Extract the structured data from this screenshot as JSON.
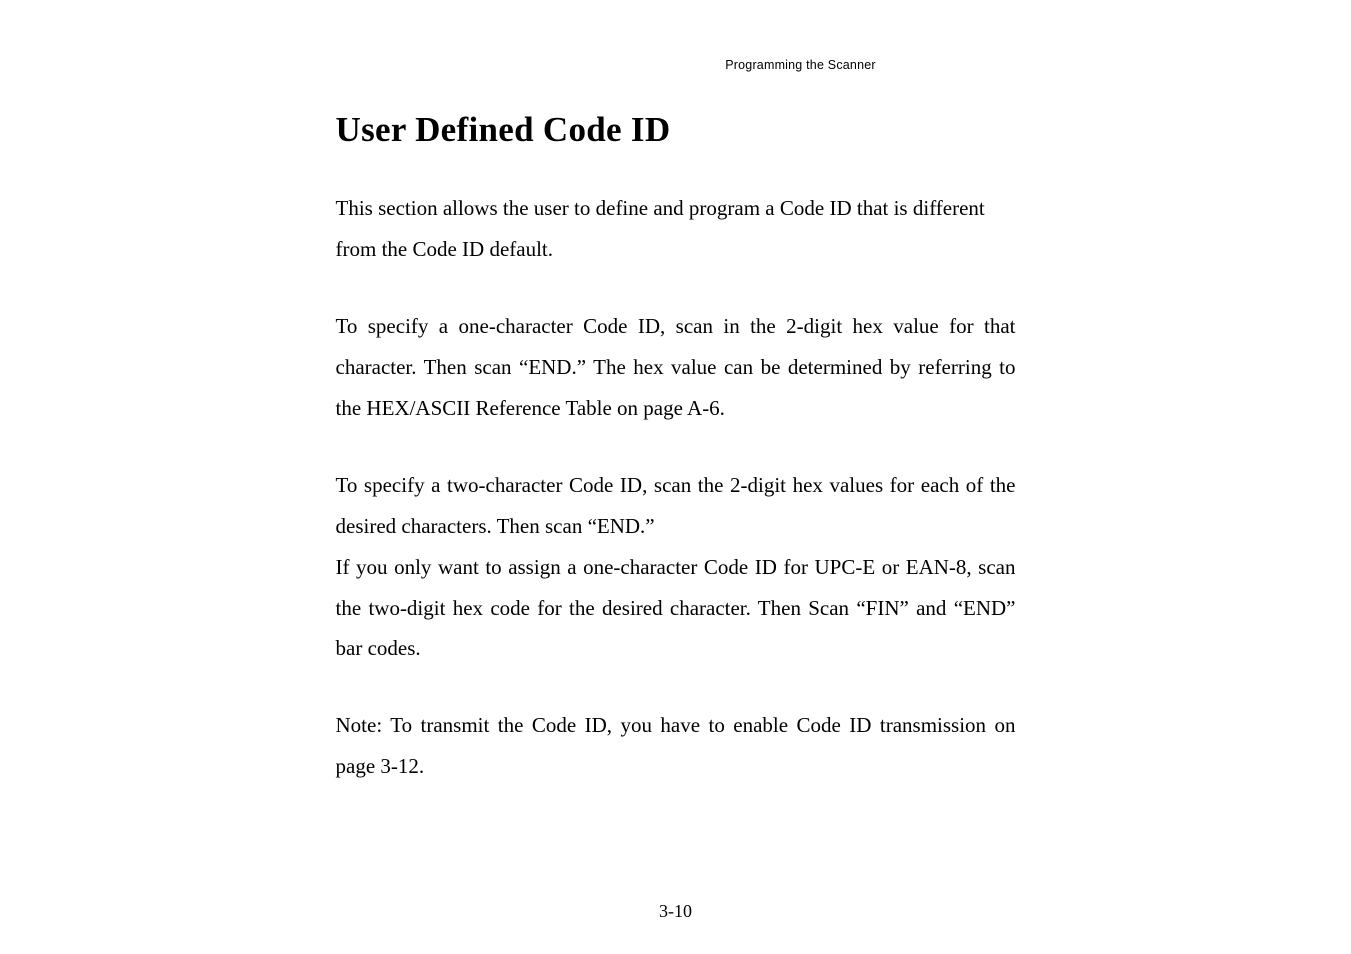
{
  "runningHeader": "Programming the Scanner",
  "title": "User Defined Code ID",
  "paragraphs": {
    "p1": "This section allows the user to define and program a Code ID that is different from the Code ID default.",
    "p2": "To specify a one-character Code ID, scan in the 2-digit hex value for that character. Then scan “END.” The hex value can be determined by referring to the HEX/ASCII Reference Table on page A-6.",
    "p3a": "To specify a two-character Code ID, scan the 2-digit hex values for each of the desired characters. Then scan “END.”",
    "p3b": "If you only want to assign a one-character Code ID for UPC-E or EAN-8, scan the two-digit hex code for the desired character. Then Scan “FIN” and “END” bar codes.",
    "p4": "Note: To transmit the Code ID, you have to enable Code ID transmission on page 3-12."
  },
  "pageNumber": "3-10"
}
